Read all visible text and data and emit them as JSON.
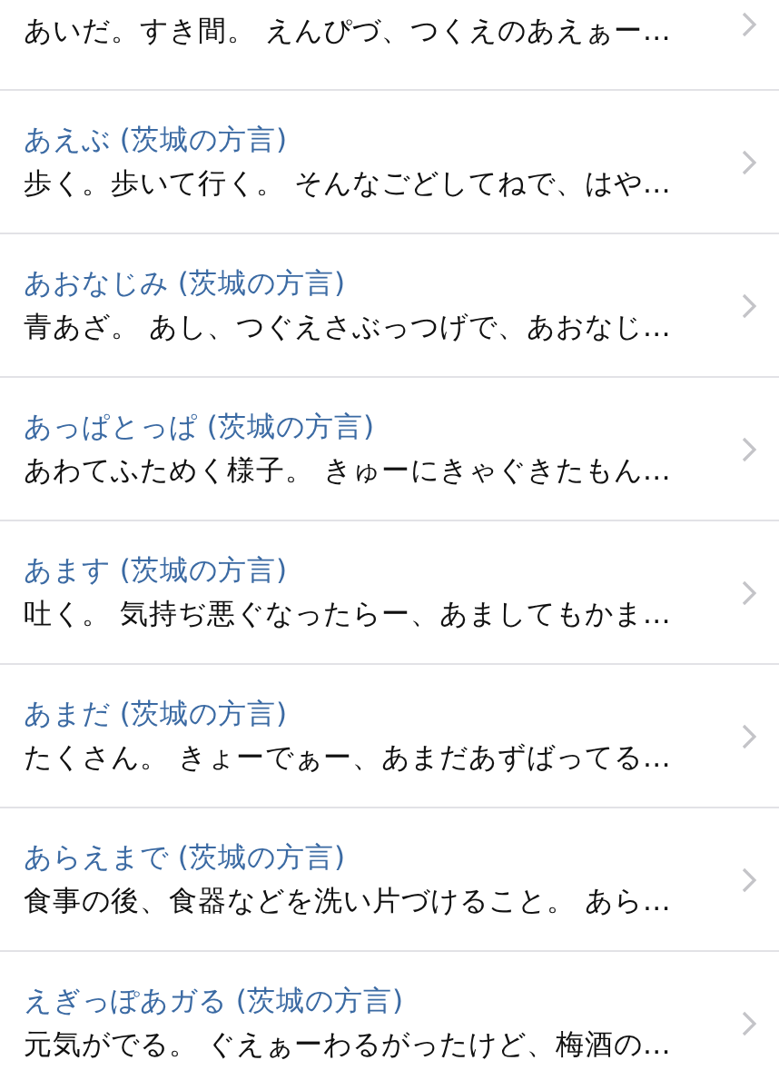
{
  "entries": [
    {
      "definition": "あいだ。すき間。 えんぴづ、つくえのあえぁー…"
    },
    {
      "title": "あえぶ (茨城の方言)",
      "definition": "歩く。歩いて行く。 そんなごどしてねで、はや…"
    },
    {
      "title": "あおなじみ (茨城の方言)",
      "definition": "青あざ。 あし、つぐえさぶっつげで、あおなじ…"
    },
    {
      "title": "あっぱとっぱ (茨城の方言)",
      "definition": "あわてふためく様子。 きゅーにきゃぐきたもん…"
    },
    {
      "title": "あます (茨城の方言)",
      "definition": "吐く。 気持ぢ悪ぐなったらー、あましてもかま…"
    },
    {
      "title": "あまだ (茨城の方言)",
      "definition": "たくさん。 きょーでぁー、あまだあずばってる…"
    },
    {
      "title": "あらえまで (茨城の方言)",
      "definition": "食事の後、食器などを洗い片づけること。 あら…"
    },
    {
      "title": "えぎっぽあガる (茨城の方言)",
      "definition": "元気がでる。 ぐえぁーわるがったけど、梅酒の…"
    }
  ]
}
